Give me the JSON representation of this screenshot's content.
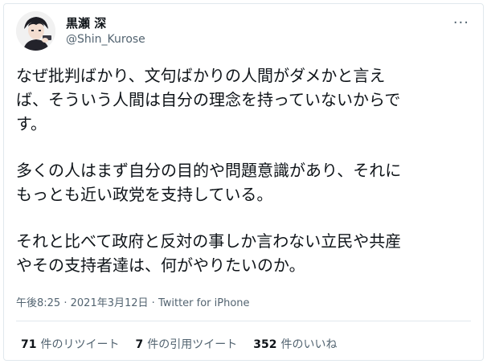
{
  "author": {
    "display_name": "黒瀬 深",
    "handle": "@Shin_Kurose"
  },
  "more_button": "···",
  "tweet": {
    "paragraphs": [
      "なぜ批判ばかり、文句ばかりの人間がダメかと言え\nば、そういう人間は自分の理念を持っていないからで\nす。",
      "多くの人はまず自分の目的や問題意識があり、それに\nもっとも近い政党を支持している。",
      "それと比べて政府と反対の事しか言わない立民や共産\nやその支持者達は、何がやりたいのか。"
    ]
  },
  "meta": {
    "time": "午後8:25",
    "date": "2021年3月12日",
    "source": "Twitter for iPhone",
    "separator": "·"
  },
  "stats": {
    "retweets_count": "71",
    "retweets_label": "件のリツイート",
    "quotes_count": "7",
    "quotes_label": "件の引用ツイート",
    "likes_count": "352",
    "likes_label": "件のいいね"
  },
  "icons": {
    "avatar": "avatar-anime-character"
  }
}
